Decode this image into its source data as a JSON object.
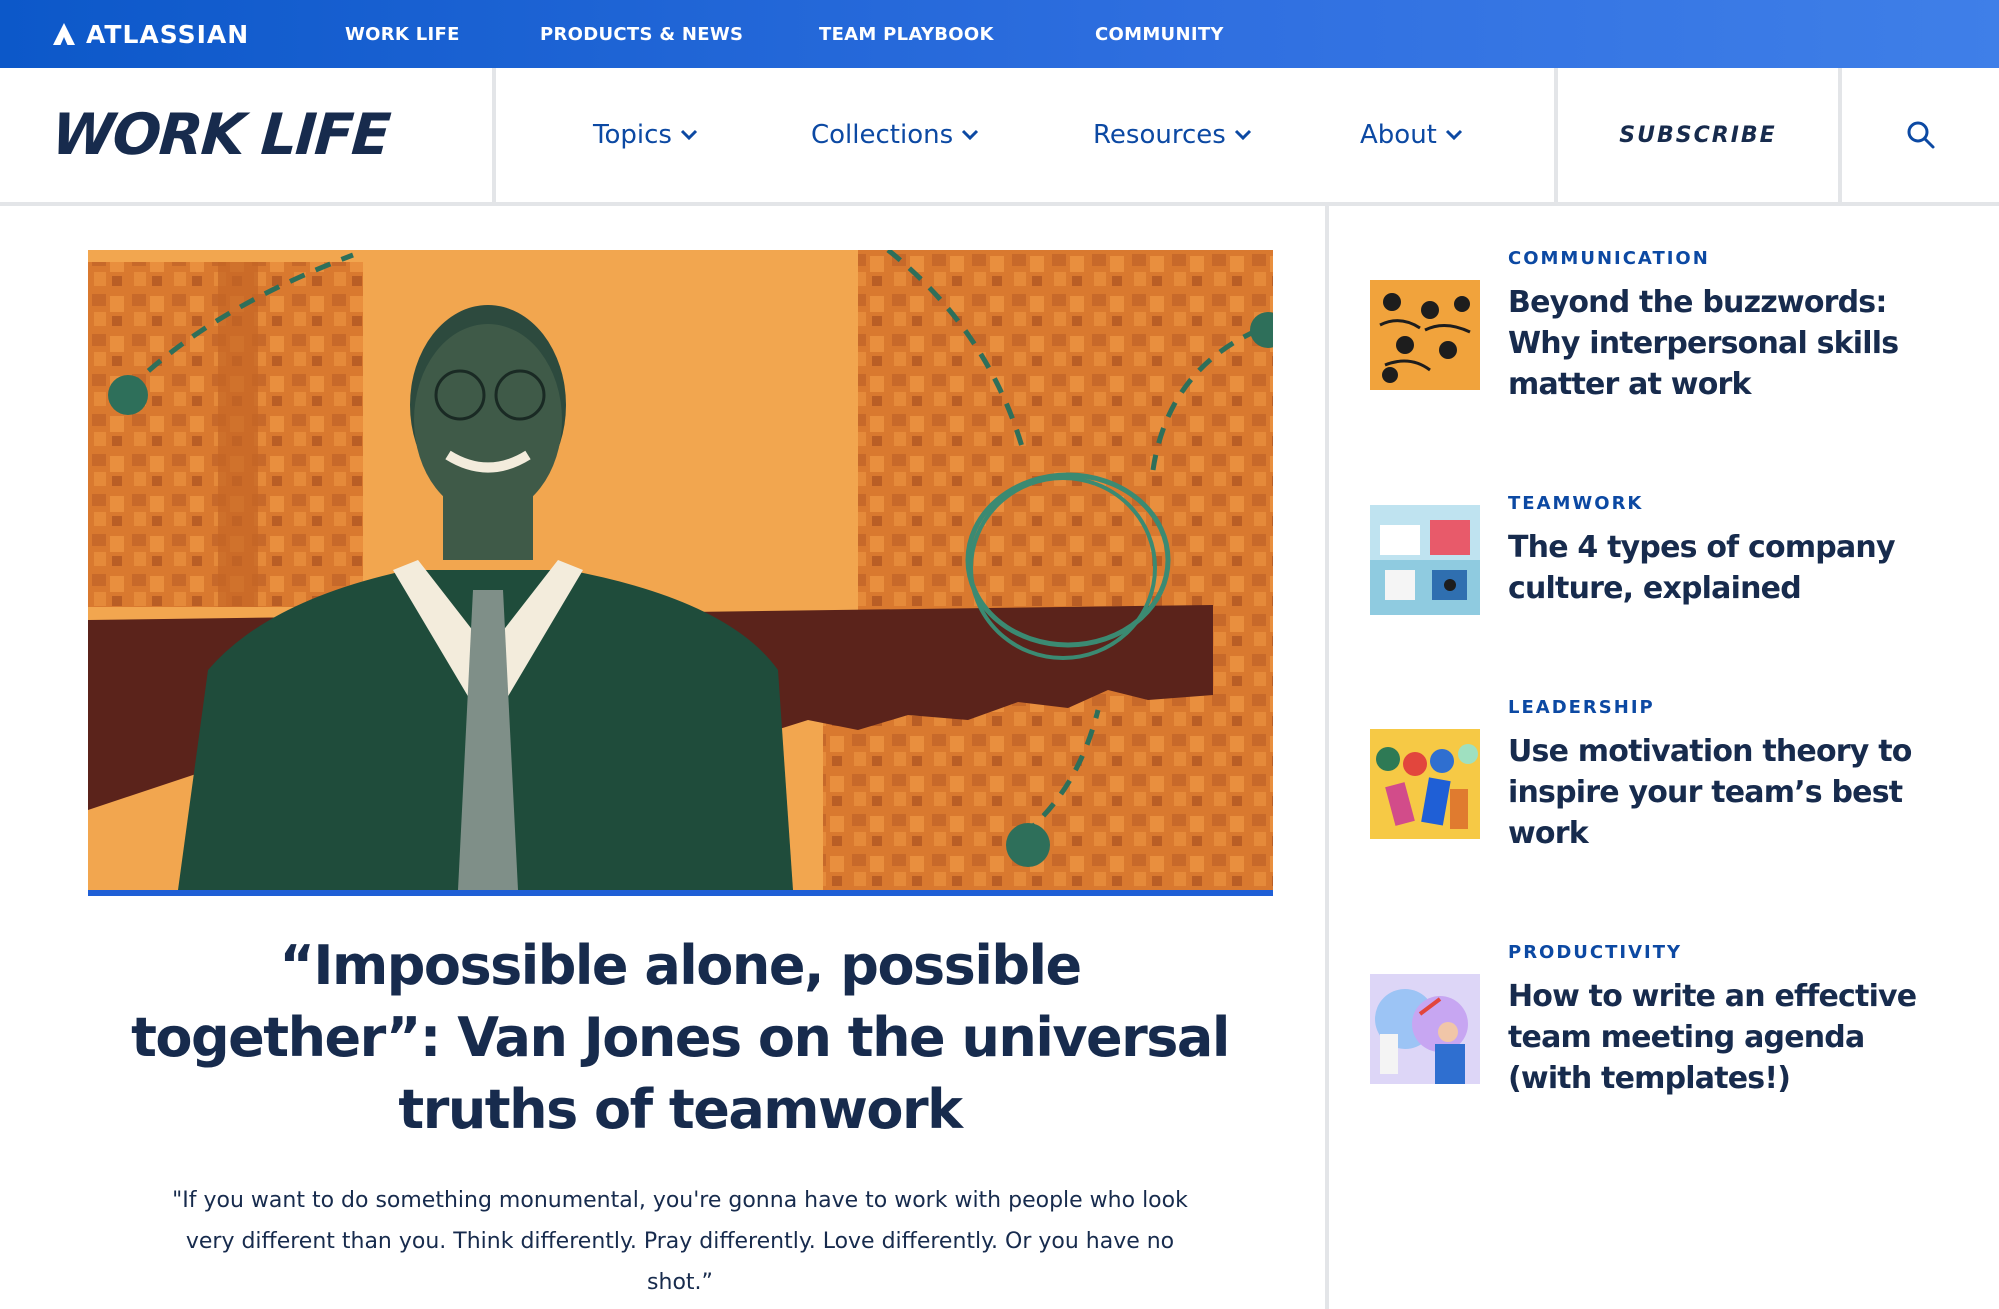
{
  "topbar": {
    "brand": "ATLASSIAN",
    "nav": [
      "WORK LIFE",
      "PRODUCTS & NEWS",
      "TEAM PLAYBOOK",
      "COMMUNITY"
    ]
  },
  "header": {
    "logo": "WORK LIFE",
    "nav": [
      "Topics",
      "Collections",
      "Resources",
      "About"
    ],
    "subscribe": "SUBSCRIBE",
    "search_icon": "search-icon"
  },
  "feature": {
    "headline": "“Impossible alone, possible together”: Van Jones on the universal truths of teamwork",
    "quote": "\"If you want to do something monumental, you're gonna have to work with people who look very different than you. Think differently. Pray differently. Love differently. Or you have no shot.”"
  },
  "sidebar": {
    "articles": [
      {
        "category": "COMMUNICATION",
        "title": "Beyond the buzzwords: Why interpersonal skills matter at work"
      },
      {
        "category": "TEAMWORK",
        "title": "The 4 types of company culture, explained"
      },
      {
        "category": "LEADERSHIP",
        "title": "Use motivation theory to inspire your team’s best work"
      },
      {
        "category": "PRODUCTIVITY",
        "title": "How to write an effective team meeting agenda (with templates!)"
      }
    ]
  },
  "colors": {
    "topbar": "#2f6fe0",
    "navy": "#172b4d",
    "link_blue": "#0c49a3",
    "hero_orange": "#f0a24a",
    "hero_accent": "#1f5fd6"
  }
}
